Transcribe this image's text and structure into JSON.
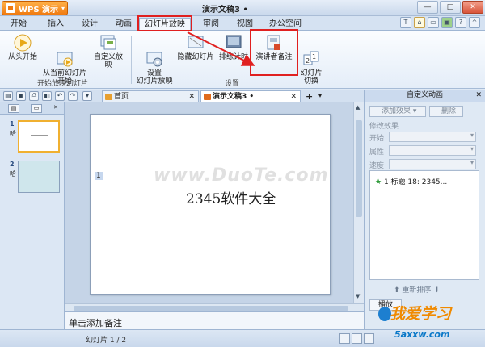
{
  "app": {
    "name": "WPS 演示",
    "doc_title": "演示文稿3 •"
  },
  "tabs": [
    "开始",
    "插入",
    "设计",
    "动画",
    "幻灯片放映",
    "审阅",
    "视图",
    "办公空间"
  ],
  "ribbon": {
    "group1": {
      "buttons": [
        {
          "label": "从头开始"
        },
        {
          "label": "从当前幻灯片\n开始"
        },
        {
          "label": "自定义放映"
        }
      ],
      "group_label": "开始放映幻灯片"
    },
    "group2": {
      "buttons": [
        {
          "label": "设置\n幻灯片放映"
        },
        {
          "label": "隐藏幻灯片"
        },
        {
          "label": "排练计时"
        },
        {
          "label": "演讲者备注"
        },
        {
          "label": "幻灯片\n切换"
        }
      ],
      "group_label": "设置"
    }
  },
  "doc_tabs": [
    {
      "label": "首页"
    },
    {
      "label": "演示文稿3 •"
    }
  ],
  "slides": [
    {
      "number": "1",
      "label": "哈"
    },
    {
      "number": "2",
      "label": "哈"
    }
  ],
  "slide": {
    "number_tag": "1",
    "text": "2345软件大全",
    "watermark": "www.DuoTe.com"
  },
  "notes": {
    "placeholder": "单击添加备注"
  },
  "right_panel": {
    "title": "自定义动画",
    "add_effect": "添加效果",
    "delete": "删除",
    "modify_label": "修改效果",
    "start_label": "开始",
    "property_label": "属性",
    "speed_label": "速度",
    "list_item": "1  标题 18: 2345...",
    "reorder": "重新排序",
    "play": "播放"
  },
  "status": {
    "slide_info": "幻灯片 1 / 2"
  },
  "brand": {
    "line1": "我爱学习",
    "line2": "5axxw.com"
  },
  "colors": {
    "highlight": "#e02020",
    "app_orange": "#f07a10"
  }
}
